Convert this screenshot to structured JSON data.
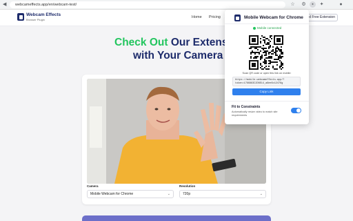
{
  "browser": {
    "url": "webcameffects.app/en/webcam-test/",
    "icons": [
      "back-icon",
      "star-icon",
      "extension-icon",
      "camera-extension-icon",
      "puzzle-icon",
      "profile-icon"
    ]
  },
  "site": {
    "logo_title": "Webcam Effects",
    "logo_subtitle": "Browser Plugin",
    "nav": [
      "Home",
      "Pricing"
    ],
    "cta": "Add Free Extension"
  },
  "hero": {
    "line1_green": "Check Out",
    "line1_rest": " Our Extens",
    "line2": "with Your Camera"
  },
  "camera": {
    "camera_label": "Camera",
    "camera_value": "Mobile Webcam for Chrome",
    "resolution_label": "Resolution",
    "resolution_value": "720p"
  },
  "popup": {
    "title": "Mobile Webcam for Chrome",
    "status": "Mobile connected",
    "scan_text": "Scan QR code or open this link on mobile:",
    "link": "https://mobile.webcameffects.app/?token=1766883C2D8E14_a6ee6c12476g",
    "copy_label": "Copy Link",
    "fit_title": "Fit to Constraints",
    "fit_desc": "Automatically resize video to match site requirements",
    "fit_enabled": true
  },
  "colors": {
    "brand_navy": "#1d2b6b",
    "accent_green": "#22c55e",
    "button_blue": "#2f80ed"
  }
}
